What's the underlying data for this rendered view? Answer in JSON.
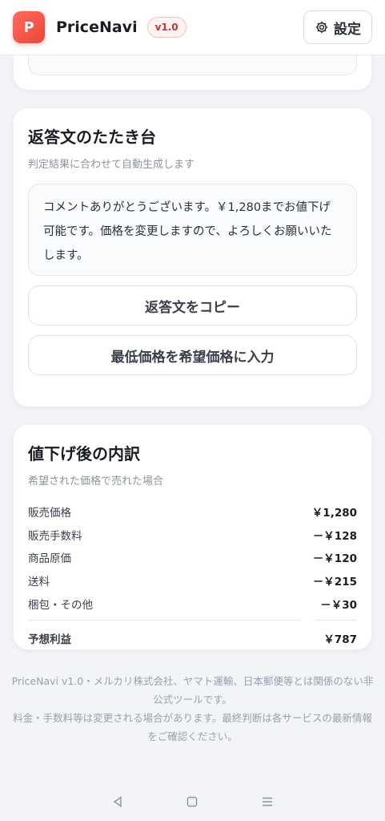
{
  "header": {
    "logo_letter": "P",
    "app_name": "PriceNavi",
    "version": "v1.0",
    "settings_label": "設定"
  },
  "reply_card": {
    "title": "返答文のたたき台",
    "subtitle": "判定結果に合わせて自動生成します",
    "text": "コメントありがとうございます。￥1,280までお値下げ可能です。価格を変更しますので、よろしくお願いいたします。",
    "copy_button": "返答文をコピー",
    "fill_button": "最低価格を希望価格に入力"
  },
  "breakdown_card": {
    "title": "値下げ後の内訳",
    "subtitle": "希望された価格で売れた場合",
    "rows": [
      {
        "label": "販売価格",
        "value": "￥1,280"
      },
      {
        "label": "販売手数料",
        "value": "－￥128"
      },
      {
        "label": "商品原価",
        "value": "－￥120"
      },
      {
        "label": "送料",
        "value": "－￥215"
      },
      {
        "label": "梱包・その他",
        "value": "－￥30"
      }
    ],
    "total_label": "予想利益",
    "total_value": "￥787"
  },
  "footer": {
    "line1": "PriceNavi v1.0・メルカリ株式会社、ヤマト運輸、日本郵便等とは関係のない非公式ツールです。",
    "line2": "料金・手数料等は変更される場合があります。最終判断は各サービスの最新情報をご確認ください。"
  },
  "navbar": {
    "icons": [
      "back-icon",
      "home-icon",
      "menu-icon"
    ]
  }
}
